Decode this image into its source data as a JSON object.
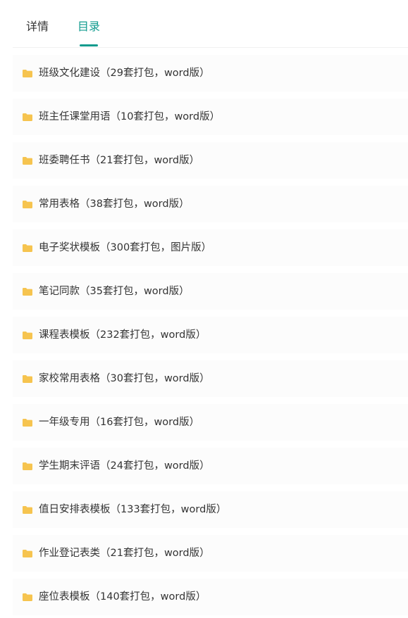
{
  "tabs": {
    "details": "详情",
    "catalog": "目录"
  },
  "colors": {
    "accent": "#0f9b8e",
    "folder": "#f6c44f",
    "row_bg": "#fcfcfc"
  },
  "icons": {
    "folder": "folder-icon"
  },
  "items": [
    "班级文化建设（29套打包，word版）",
    "班主任课堂用语（10套打包，word版）",
    "班委聘任书（21套打包，word版）",
    "常用表格（38套打包，word版）",
    "电子奖状模板（300套打包，图片版）",
    "笔记同款（35套打包，word版）",
    "课程表模板（232套打包，word版）",
    "家校常用表格（30套打包，word版）",
    "一年级专用（16套打包，word版）",
    "学生期末评语（24套打包，word版）",
    "值日安排表模板（133套打包，word版）",
    "作业登记表类（21套打包，word版）",
    "座位表模板（140套打包，word版）"
  ]
}
